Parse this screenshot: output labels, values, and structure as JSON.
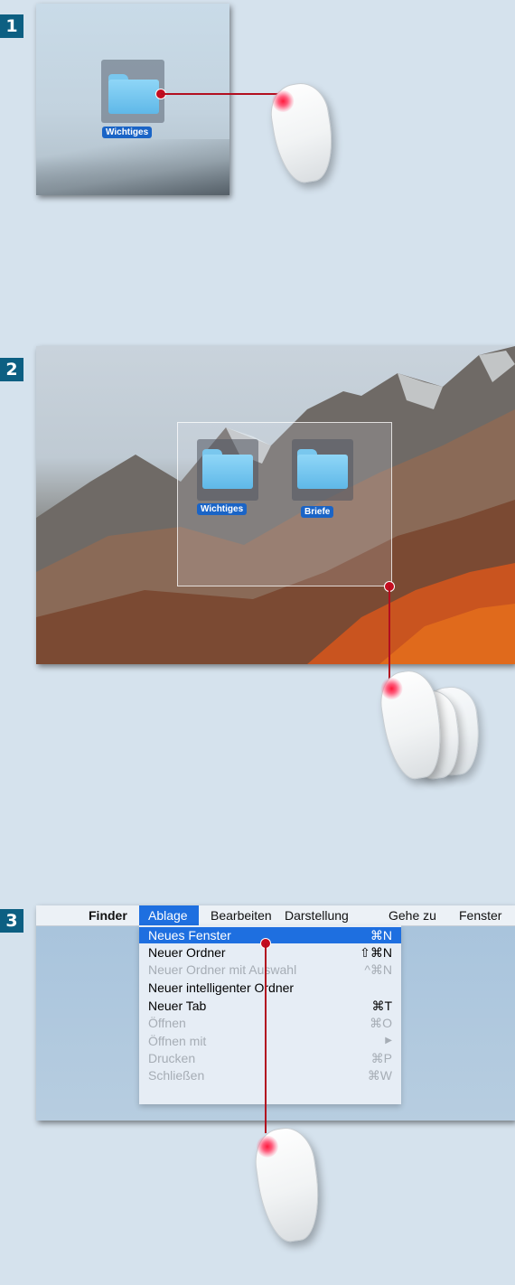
{
  "steps": [
    {
      "number": "1"
    },
    {
      "number": "2"
    },
    {
      "number": "3"
    }
  ],
  "step1": {
    "folder_label": "Wichtiges"
  },
  "step2": {
    "folders": [
      {
        "label": "Wichtiges"
      },
      {
        "label": "Briefe"
      }
    ]
  },
  "step3": {
    "apple_menu": "",
    "menubar": [
      "Finder",
      "Ablage",
      "Bearbeiten",
      "Darstellung",
      "Gehe zu",
      "Fenster"
    ],
    "menu_items": [
      {
        "label": "Neues Fenster",
        "shortcut": "⌘N",
        "enabled": true,
        "highlighted": true
      },
      {
        "label": "Neuer Ordner",
        "shortcut": "⇧⌘N",
        "enabled": true
      },
      {
        "label": "Neuer Ordner mit Auswahl",
        "shortcut": "^⌘N",
        "enabled": false
      },
      {
        "label": "Neuer intelligenter Ordner",
        "shortcut": "",
        "enabled": true
      },
      {
        "label": "Neuer Tab",
        "shortcut": "⌘T",
        "enabled": true
      },
      {
        "label": "Öffnen",
        "shortcut": "⌘O",
        "enabled": false
      },
      {
        "label": "Öffnen mit",
        "shortcut": "▶",
        "enabled": false
      },
      {
        "label": "Drucken",
        "shortcut": "⌘P",
        "enabled": false
      },
      {
        "label": "Schließen",
        "shortcut": "⌘W",
        "enabled": false
      }
    ]
  },
  "colors": {
    "badge": "#0d5f82",
    "connector": "#b20e1f",
    "menu_highlight": "#1e6fe0",
    "folder": "#79c7ee"
  }
}
